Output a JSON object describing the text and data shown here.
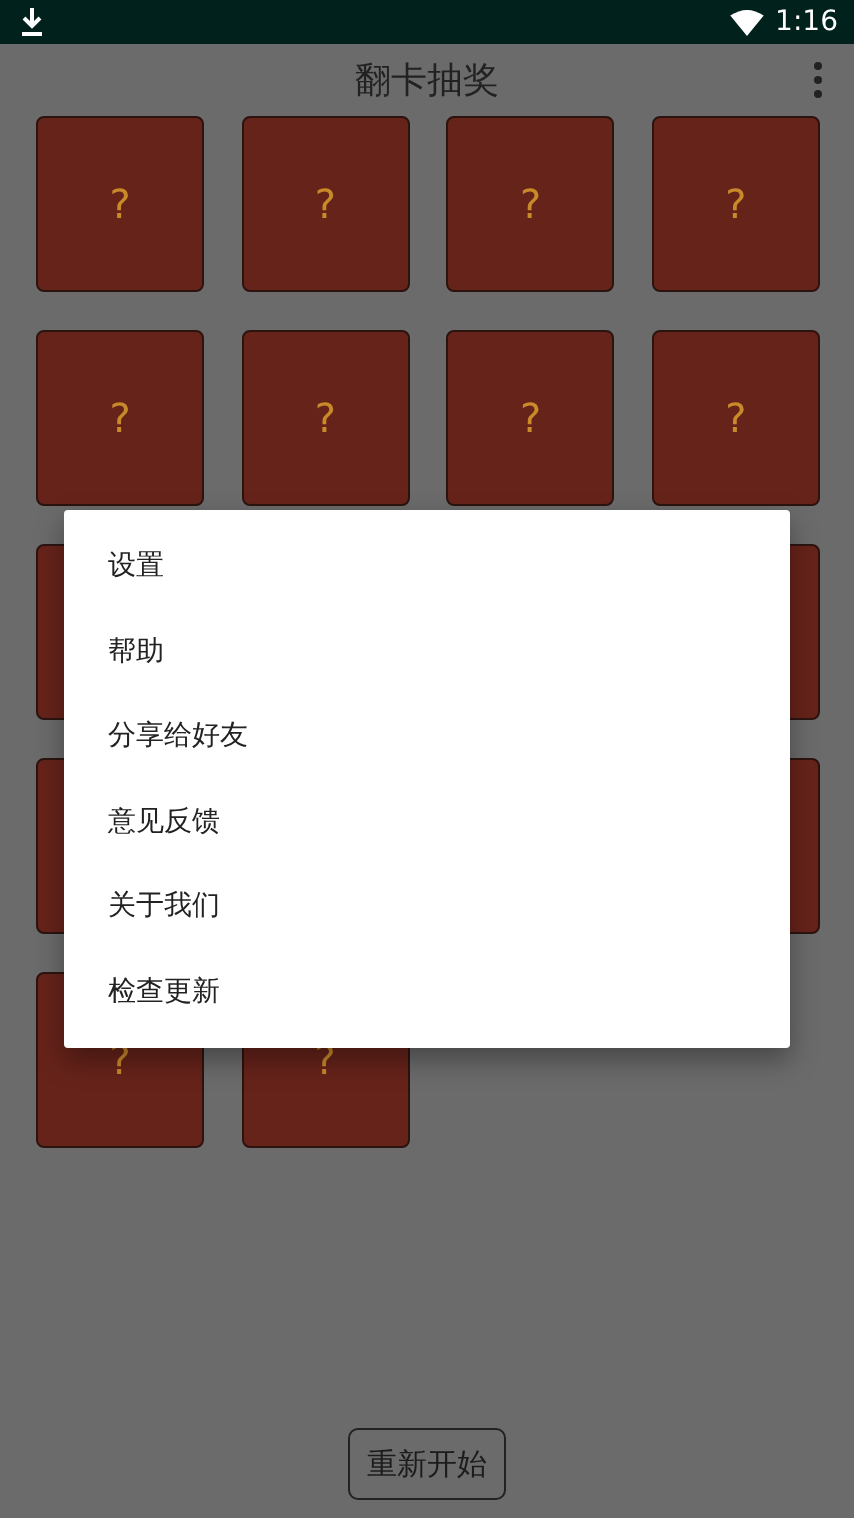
{
  "status_bar": {
    "time": "1:16"
  },
  "app_bar": {
    "title": "翻卡抽奖"
  },
  "card_rows": [
    {
      "kind": "full",
      "cards": [
        {
          "label": "?"
        },
        {
          "label": "?"
        },
        {
          "label": "?"
        },
        {
          "label": "?"
        }
      ]
    },
    {
      "kind": "full",
      "cards": [
        {
          "label": "?"
        },
        {
          "label": "?"
        },
        {
          "label": "?"
        },
        {
          "label": "?"
        }
      ]
    },
    {
      "kind": "edges"
    },
    {
      "kind": "edges"
    },
    {
      "kind": "last",
      "cards": [
        {
          "label": "?"
        },
        {
          "label": "?"
        }
      ]
    }
  ],
  "menu": {
    "items": [
      "设置",
      "帮助",
      "分享给好友",
      "意见反馈",
      "关于我们",
      "检查更新"
    ]
  },
  "restart_button": "重新开始"
}
